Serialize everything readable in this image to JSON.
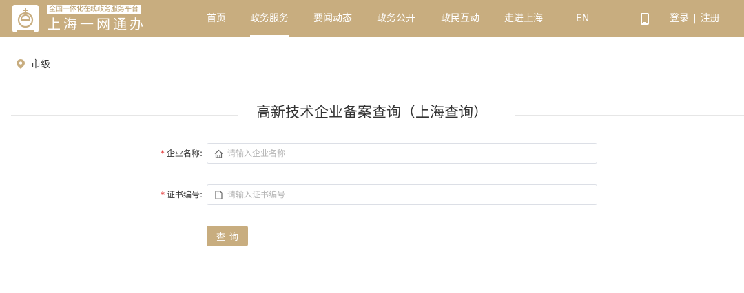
{
  "header": {
    "logo_slogan": "全国一体化在线政务服务平台",
    "logo_name": "上海一网通办",
    "nav": [
      {
        "label": "首页"
      },
      {
        "label": "政务服务"
      },
      {
        "label": "要闻动态"
      },
      {
        "label": "政务公开"
      },
      {
        "label": "政民互动"
      },
      {
        "label": "走进上海"
      },
      {
        "label": "EN"
      }
    ],
    "active_nav": "政务服务",
    "login_label": "登录",
    "separator": "|",
    "register_label": "注册"
  },
  "location": {
    "label": "市级"
  },
  "page": {
    "title": "高新技术企业备案查询（上海查询）"
  },
  "form": {
    "required_mark": "*",
    "company": {
      "label": "企业名称:",
      "placeholder": "请输入企业名称",
      "value": ""
    },
    "certificate": {
      "label": "证书编号:",
      "placeholder": "请输入证书编号",
      "value": ""
    },
    "submit_label": "查询"
  },
  "colors": {
    "brand": "#c8ad7f",
    "required": "#e02020"
  },
  "icons": {
    "location": "pin-icon",
    "company_field": "home-icon",
    "certificate_field": "document-icon",
    "phone": "phone-icon"
  }
}
